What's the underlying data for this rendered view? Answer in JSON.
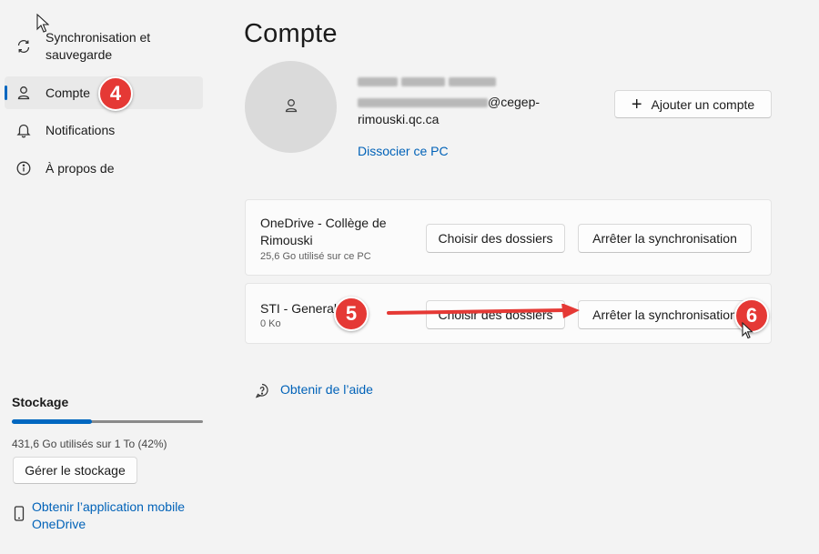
{
  "sidebar": {
    "items": [
      {
        "label": "Synchronisation et sauvegarde",
        "icon": "sync-icon"
      },
      {
        "label": "Compte",
        "icon": "person-icon"
      },
      {
        "label": "Notifications",
        "icon": "bell-icon"
      },
      {
        "label": "À propos de",
        "icon": "info-icon"
      }
    ],
    "storage": {
      "title": "Stockage",
      "usage_text": "431,6 Go utilisés sur 1 To (42%)",
      "usage_fraction": 0.42,
      "manage_button": "Gérer le stockage"
    },
    "mobile_link": "Obtenir l’application mobile OneDrive"
  },
  "main": {
    "title": "Compte",
    "account": {
      "email_suffix": "@cegep-rimouski.qc.ca",
      "unlink_link": "Dissocier ce PC",
      "add_account_button": "Ajouter un compte"
    },
    "libraries": [
      {
        "name": "OneDrive - Collège de Rimouski",
        "detail": "25,6 Go utilisé sur ce PC",
        "choose_button": "Choisir des dossiers",
        "stop_button": "Arrêter la synchronisation"
      },
      {
        "name": "STI - General",
        "detail": "0 Ko",
        "choose_button": "Choisir des dossiers",
        "stop_button": "Arrêter la synchronisation"
      }
    ],
    "help_link": "Obtenir de l’aide"
  },
  "annotations": {
    "badges": [
      "4",
      "5",
      "6"
    ],
    "badge_color": "#e53935"
  },
  "colors": {
    "accent": "#0067c0",
    "link": "#0062b8",
    "background": "#f3f3f3"
  }
}
